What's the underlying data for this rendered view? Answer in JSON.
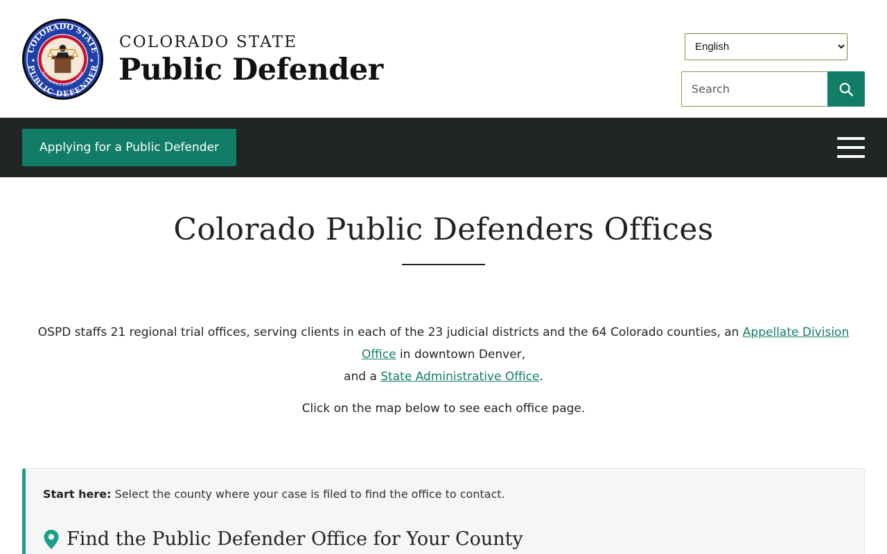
{
  "header": {
    "seal_text_top": "COLORADO STATE",
    "seal_text_bottom": "PUBLIC DEFENDER",
    "seal_motto": "THAT JUSTICE ESCAPE NONE",
    "brand_small": "COLORADO STATE",
    "brand_big": "Public Defender",
    "language": {
      "selected": "English",
      "options": [
        "English"
      ]
    },
    "search": {
      "placeholder": "Search",
      "icon": "search-icon"
    }
  },
  "nav": {
    "apply_label": "Applying for a Public Defender",
    "menu_icon": "hamburger-menu-icon"
  },
  "main": {
    "title": "Colorado Public Defenders Offices",
    "intro_part1": "OSPD staffs 21 regional trial offices, serving clients in each of the 23 judicial districts and the 64 Colorado counties, an ",
    "link_appellate": "Appellate Division Office",
    "intro_part2": " in downtown Denver,",
    "intro_part3": "and a ",
    "link_admin": "State Administrative Office",
    "intro_part4": ".",
    "click_note": "Click on the map below to see each office page."
  },
  "callout": {
    "start_label": "Start here:",
    "start_text": " Select the county where your case is filed to find the office to contact.",
    "heading": "Find the Public Defender Office for Your County",
    "icon": "map-pin-icon"
  },
  "colors": {
    "accent": "#127d67",
    "navbar": "#222525",
    "callout_border": "#1aa088"
  }
}
